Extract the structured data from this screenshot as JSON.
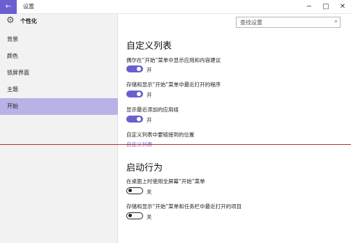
{
  "window": {
    "title": "设置",
    "back_icon": "←",
    "controls": [
      "−",
      "□",
      "✕"
    ]
  },
  "sidebar": {
    "header_title": "个性化",
    "items": [
      {
        "label": "背景"
      },
      {
        "label": "颜色"
      },
      {
        "label": "锁屏界面"
      },
      {
        "label": "主题"
      },
      {
        "label": "开始"
      }
    ],
    "active_index": 4
  },
  "search": {
    "placeholder": "查找设置",
    "icon": "⌕"
  },
  "sections": {
    "customize": {
      "title": "自定义列表",
      "settings": [
        {
          "label": "偶尔在“开始”菜单中显示应用和内容建议",
          "state": "开",
          "on": true
        },
        {
          "label": "存储和显示“开始”菜单中最近打开的程序",
          "state": "开",
          "on": true
        },
        {
          "label": "显示最近添加的应用组",
          "state": "开",
          "on": true
        }
      ],
      "link_caption": "自定义列表中要链接到的位置",
      "link_text": "自定义列表"
    },
    "startup": {
      "title": "启动行为",
      "settings": [
        {
          "label": "在桌面上时使用全屏幕“开始”菜单",
          "state": "关",
          "on": false
        },
        {
          "label": "存储和显示“开始”菜单和任务栏中最近打开的项目",
          "state": "关",
          "on": false
        }
      ]
    }
  },
  "colors": {
    "accent": "#6a5fcf",
    "active_nav": "#b8b2e6",
    "link": "#8b6fd6"
  }
}
